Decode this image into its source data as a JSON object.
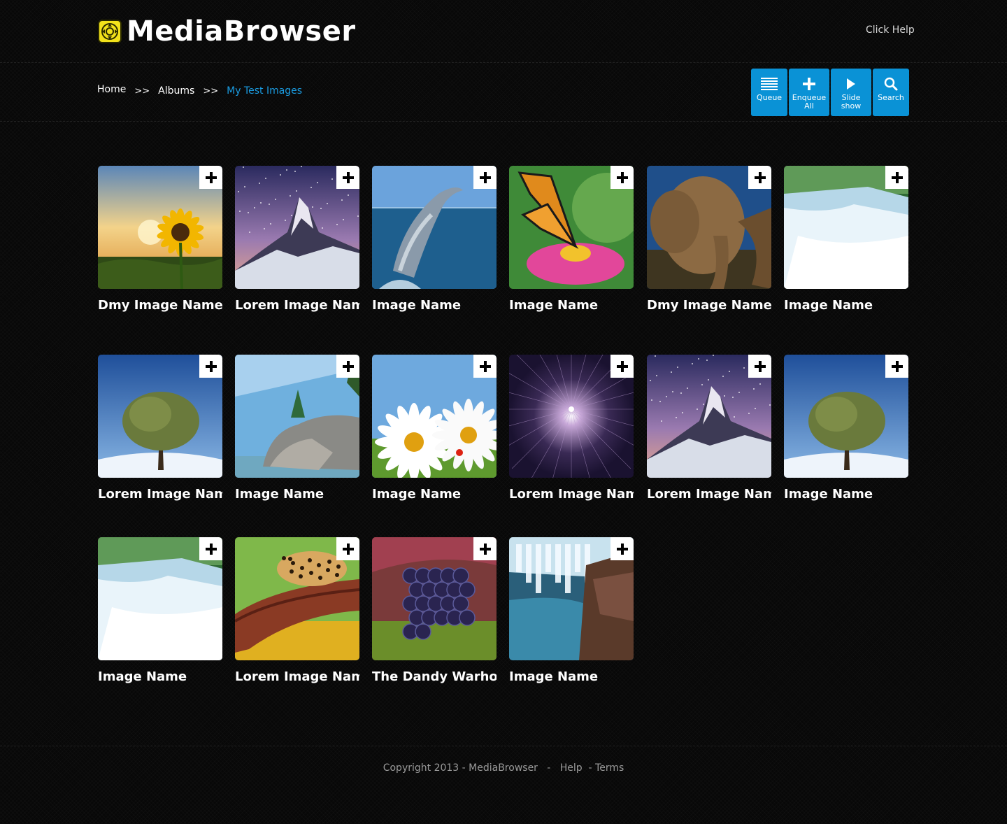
{
  "app": {
    "title": "MediaBrowser",
    "help_label": "Click Help"
  },
  "breadcrumb": {
    "items": [
      "Home",
      "Albums",
      "My Test Images"
    ],
    "separator": ">>"
  },
  "toolbar": {
    "queue": "Queue",
    "enqueue_line1": "Enqueue",
    "enqueue_line2": "All",
    "slideshow_line1": "Slide",
    "slideshow_line2": "show",
    "search": "Search"
  },
  "colors": {
    "accent": "#0a92d6",
    "link_active": "#1a9be0",
    "logo": "#f2e21b"
  },
  "gallery": {
    "items": [
      {
        "title": "Dmy Image Name..",
        "image": "sunflower-icon"
      },
      {
        "title": "Lorem Image Nam..",
        "image": "mountain-icon"
      },
      {
        "title": "Image Name",
        "image": "dolphin-icon"
      },
      {
        "title": "Image Name",
        "image": "butterfly-icon"
      },
      {
        "title": "Dmy Image Name..",
        "image": "elephant-icon"
      },
      {
        "title": "Image Name",
        "image": "waterfall-icon"
      },
      {
        "title": "Lorem Image Nam..",
        "image": "tree-icon"
      },
      {
        "title": "Image Name",
        "image": "rocks-icon"
      },
      {
        "title": "Image Name",
        "image": "daisy-icon"
      },
      {
        "title": "Lorem Image Nam..",
        "image": "star-icon"
      },
      {
        "title": "Lorem Image Nam..",
        "image": "mountain-icon"
      },
      {
        "title": "Image Name",
        "image": "tree-icon"
      },
      {
        "title": "Image Name",
        "image": "waterfall-icon"
      },
      {
        "title": "Lorem Image Nam..",
        "image": "leopard-icon"
      },
      {
        "title": "The Dandy Warhoi..",
        "image": "blackberry-icon"
      },
      {
        "title": "Image Name",
        "image": "cascade-icon"
      }
    ]
  },
  "footer": {
    "copyright": "Copyright 2013 - MediaBrowser",
    "dash": "-",
    "help": "Help",
    "terms": "- Terms"
  }
}
